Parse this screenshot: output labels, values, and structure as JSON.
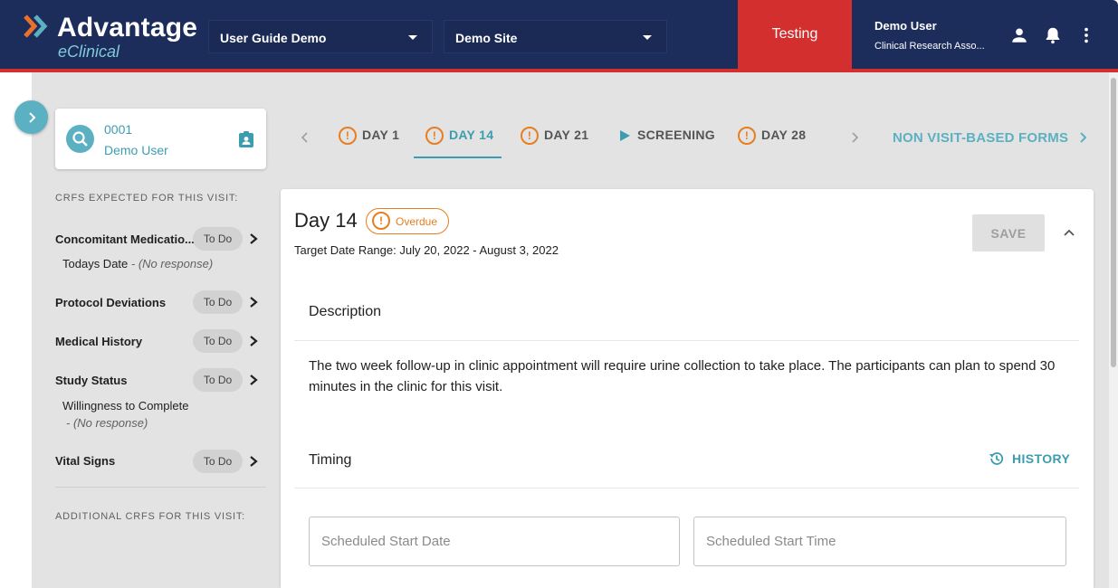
{
  "header": {
    "logo_title": "Advantage",
    "logo_subtitle": "eClinical",
    "study_select": "User Guide Demo",
    "site_select": "Demo Site",
    "environment_label": "Testing",
    "user_name": "Demo User",
    "user_role": "Clinical Research Asso...",
    "icons": [
      "person-icon",
      "bell-icon",
      "more-vertical-icon"
    ]
  },
  "participant": {
    "id": "0001",
    "name": "Demo User"
  },
  "sidebar": {
    "expected_label": "CRFS EXPECTED FOR THIS VISIT:",
    "crfs": [
      {
        "name": "Concomitant Medicatio...",
        "status": "To Do",
        "sub_label": "Todays Date",
        "sub_value": " - (No response)"
      },
      {
        "name": "Protocol Deviations",
        "status": "To Do"
      },
      {
        "name": "Medical History",
        "status": "To Do"
      },
      {
        "name": "Study Status",
        "status": "To Do",
        "sub_label": "Willingness to Complete",
        "sub_value": "- (No response)"
      },
      {
        "name": "Vital Signs",
        "status": "To Do"
      }
    ],
    "additional_label": "ADDITIONAL CRFS FOR THIS VISIT:"
  },
  "visit_tabs": {
    "tabs": [
      {
        "label": "DAY 1",
        "icon": "warning-icon"
      },
      {
        "label": "DAY 14",
        "icon": "warning-icon",
        "active": true
      },
      {
        "label": "DAY 21",
        "icon": "warning-icon"
      },
      {
        "label": "SCREENING",
        "icon": "play-icon"
      },
      {
        "label": "DAY 28",
        "icon": "warning-icon"
      }
    ],
    "non_visit_label": "NON VISIT-BASED FORMS"
  },
  "visit": {
    "title": "Day 14",
    "status_badge": "Overdue",
    "target_range": "Target Date Range: July 20, 2022 - August 3, 2022",
    "save_label": "SAVE",
    "description_title": "Description",
    "description_text": "The two week follow-up in clinic appointment will require urine collection to take place. The participants can plan to spend 30 minutes in the clinic for this visit.",
    "timing_title": "Timing",
    "history_label": "HISTORY",
    "start_date_placeholder": "Scheduled Start Date",
    "start_time_placeholder": "Scheduled Start Time"
  },
  "colors": {
    "header_bg": "#1c2d5c",
    "accent_red": "#d32f2f",
    "teal": "#3c9db0",
    "warning_orange": "#e67e22"
  }
}
